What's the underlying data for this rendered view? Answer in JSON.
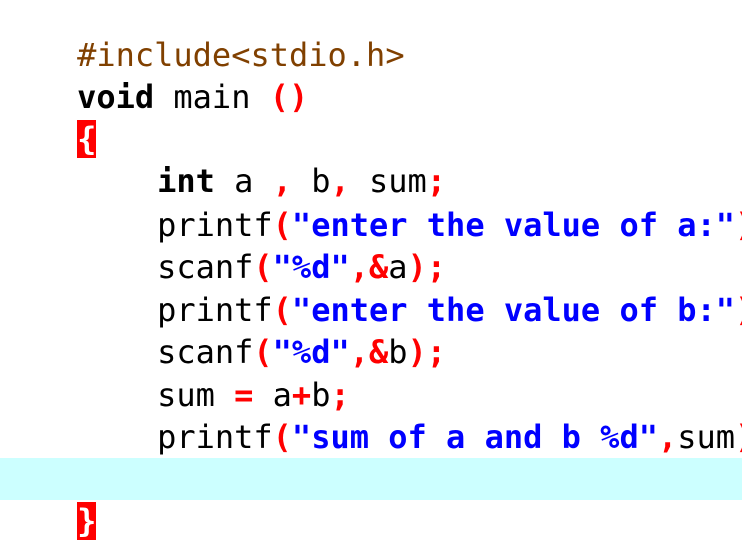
{
  "editor": {
    "colors": {
      "background": "#ffffff",
      "current_line": "#ccffff",
      "preprocessor": "#804000",
      "keyword": "#000000",
      "operator": "#ff0000",
      "string": "#0000ff",
      "brace_match_bg": "#ff0000"
    },
    "lines": {
      "l1": {
        "preproc": "#include<stdio.h>"
      },
      "l2": {
        "kw": "void",
        "name": " main ",
        "parens": "()"
      },
      "l3": {
        "brace": "{"
      },
      "l4": {
        "kw": "int",
        "a": " a ",
        "c1": ",",
        "b": " b",
        "c2": ",",
        "sum": " sum",
        "semi": ";"
      },
      "l5": {
        "fn": "printf",
        "open": "(",
        "str": "\"enter the value of a:\"",
        "close": ")",
        "semi": ";"
      },
      "l6": {
        "fn": "scanf",
        "open": "(",
        "str": "\"%d\"",
        "comma": ",",
        "amp": "&",
        "var": "a",
        "close": ")",
        "semi": ";"
      },
      "l7": {
        "fn": "printf",
        "open": "(",
        "str": "\"enter the value of b:\"",
        "close": ")",
        "semi": ";"
      },
      "l8": {
        "fn": "scanf",
        "open": "(",
        "str": "\"%d\"",
        "comma": ",",
        "amp": "&",
        "var": "b",
        "close": ")",
        "semi": ";"
      },
      "l9": {
        "lhs": "sum ",
        "eq": "=",
        "a": " a",
        "plus": "+",
        "b": "b",
        "semi": ";"
      },
      "l10": {
        "fn": "printf",
        "open": "(",
        "str": "\"sum of a and b %d\"",
        "comma": ",",
        "var": "sum",
        "close": ")",
        "semi": ";"
      },
      "l12": {
        "brace": "}"
      }
    }
  }
}
